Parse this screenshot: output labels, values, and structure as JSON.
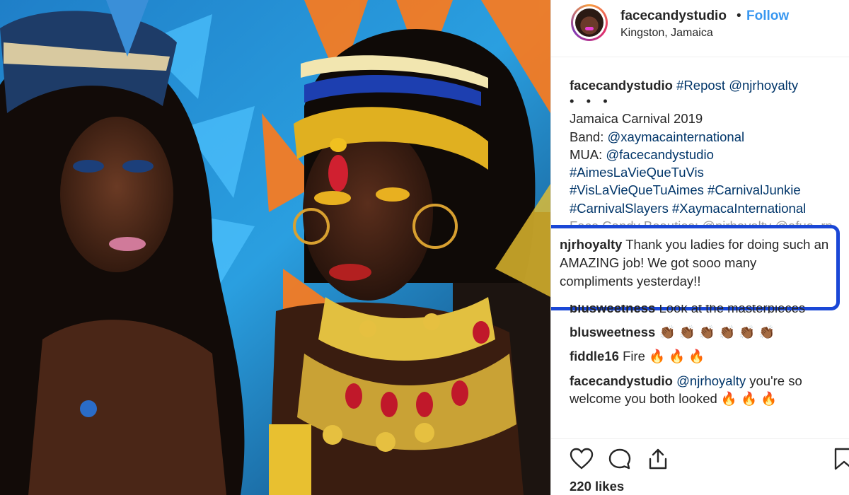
{
  "post": {
    "username": "facecandystudio",
    "separator": "•",
    "follow_label": "Follow",
    "location": "Kingston, Jamaica",
    "photo_alt": "Two women in carnival costumes"
  },
  "caption": {
    "username": "facecandystudio",
    "repost": "#Repost",
    "repost_user": "@njrhoyalty",
    "dots": "• • •",
    "line1": "Jamaica Carnival 2019",
    "band_label": "Band:",
    "band": "@xaymacainternational",
    "mua_label": "MUA:",
    "mua": "@facecandystudio",
    "tag1": "#AimesLaVieQueTuVis",
    "tag2": "#VisLaVieQueTuAimes",
    "tag3": "#CarnivalJunkie",
    "tag4": "#CarnivalSlayers",
    "tag5": "#XaymacaInternational",
    "faded_line": "Face Candy Beauties: @njrhoyalty @afua_rn"
  },
  "comments": [
    {
      "username": "njrhoyalty",
      "text": "Thank you ladies for doing such an AMAZING job! We got sooo many compliments yesterday!!"
    },
    {
      "username": "blusweetness",
      "text": "Look at the masterpieces"
    },
    {
      "username": "blusweetness",
      "text": "👏🏾 👏🏾 👏🏾 👏🏾 👏🏾 👏🏾"
    },
    {
      "username": "fiddle16",
      "text": "Fire",
      "emoji": "🔥 🔥 🔥"
    },
    {
      "username": "facecandystudio",
      "mention": "@njrhoyalty",
      "text": "you're so welcome you both looked",
      "emoji": "🔥 🔥 🔥"
    }
  ],
  "actions": {
    "likes": "220 likes",
    "icons": [
      "heart-icon",
      "comment-icon",
      "share-icon",
      "bookmark-icon"
    ]
  },
  "colors": {
    "link": "#003569",
    "follow": "#3897f0",
    "highlight_border": "#1a47d6",
    "text": "#262626"
  }
}
